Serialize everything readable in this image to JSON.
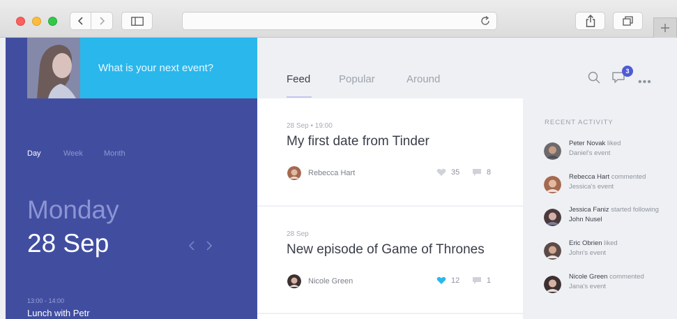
{
  "hero": {
    "prompt": "What is your next event?"
  },
  "calendar": {
    "periods": [
      "Day",
      "Week",
      "Month"
    ],
    "day_name": "Monday",
    "date": "28 Sep",
    "event": {
      "time": "13:00 - 14:00",
      "title": "Lunch with Petr"
    }
  },
  "tabs": [
    "Feed",
    "Popular",
    "Around"
  ],
  "notifications": {
    "count": "3"
  },
  "feed": [
    {
      "meta": "28 Sep • 19:00",
      "title": "My first date from Tinder",
      "author": "Rebecca Hart",
      "likes": "35",
      "comments": "8",
      "liked": false
    },
    {
      "meta": "28 Sep",
      "title": "New episode of Game of Thrones",
      "author": "Nicole Green",
      "likes": "12",
      "comments": "1",
      "liked": true
    }
  ],
  "activity": {
    "heading": "RECENT ACTIVITY",
    "items": [
      {
        "name": "Peter Novak",
        "action": "liked",
        "object": "Daniel's event",
        "object_bold": false
      },
      {
        "name": "Rebecca Hart",
        "action": "commented",
        "object": "Jessica's event",
        "object_bold": false
      },
      {
        "name": "Jessica Faniz",
        "action": "started following",
        "object": "John Nusel",
        "object_bold": true
      },
      {
        "name": "Eric Obrien",
        "action": "liked",
        "object": "John's event",
        "object_bold": false
      },
      {
        "name": "Nicole Green",
        "action": "commented",
        "object": "Jana's event",
        "object_bold": false
      }
    ]
  },
  "colors": {
    "sidebar": "#414ea0",
    "accent_cyan": "#2ab7ec",
    "badge": "#4f5bd5",
    "liked_heart": "#2ab7ec"
  }
}
